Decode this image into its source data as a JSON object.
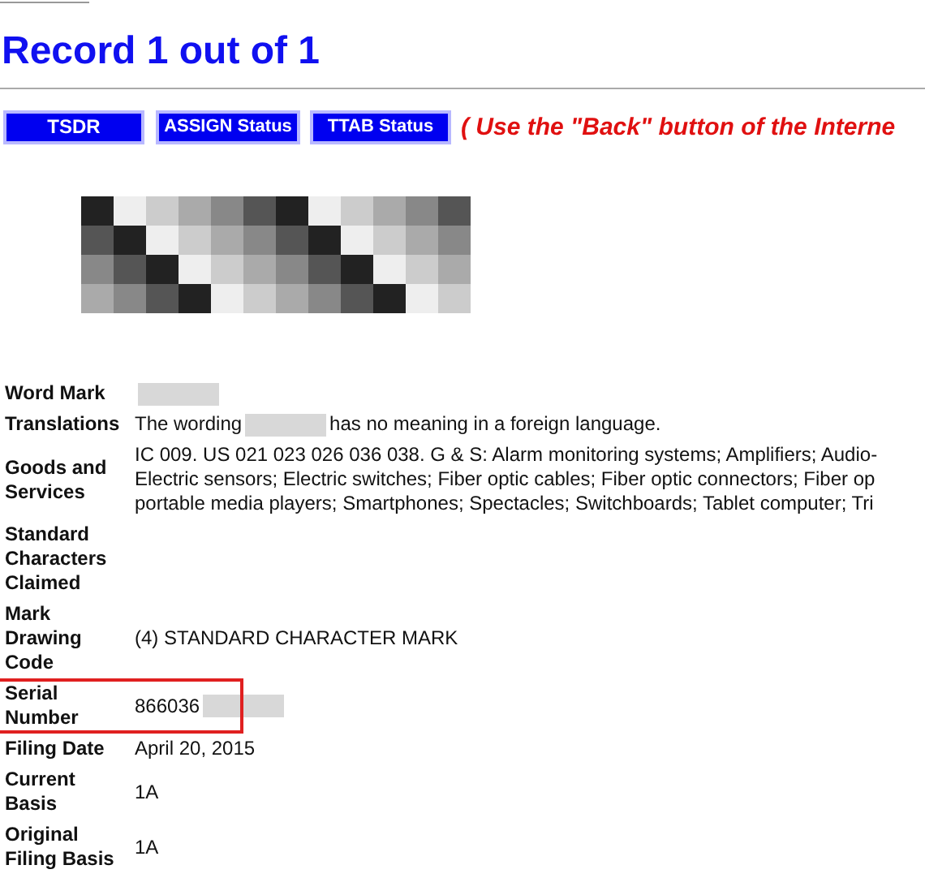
{
  "title": "Record 1 out of 1",
  "buttons": [
    {
      "label": "TSDR"
    },
    {
      "label": "ASSIGN Status"
    },
    {
      "label": "TTAB Status"
    }
  ],
  "back_note": "( Use the \"Back\" button of the Interne",
  "fields": [
    {
      "label": "Word Mark",
      "kind": "masked",
      "highlighted": false
    },
    {
      "label": "Translations",
      "kind": "masked",
      "before": "The wording",
      "after": "has no meaning in a foreign language.",
      "highlighted": false
    },
    {
      "label": "Goods and Services",
      "kind": "lines",
      "lines": [
        "IC 009. US 021 023 026 036 038. G & S: Alarm monitoring systems; Amplifiers; Audio-",
        "Electric sensors; Electric switches; Fiber optic cables; Fiber optic connectors; Fiber op",
        "portable media players; Smartphones; Spectacles; Switchboards; Tablet computer; Tri"
      ],
      "highlighted": false
    },
    {
      "label": "Standard Characters Claimed",
      "kind": "blank",
      "highlighted": false
    },
    {
      "label": "Mark Drawing Code",
      "kind": "text",
      "value": "(4) STANDARD CHARACTER MARK",
      "highlighted": false
    },
    {
      "label": "Serial Number",
      "kind": "masked",
      "before": "866036",
      "highlighted": true
    },
    {
      "label": "Filing Date",
      "kind": "text",
      "value": "April 20, 2015",
      "highlighted": false
    },
    {
      "label": "Current Basis",
      "kind": "text",
      "value": "1A",
      "highlighted": false
    },
    {
      "label": "Original Filing Basis",
      "kind": "text",
      "value": "1A",
      "highlighted": false
    }
  ]
}
